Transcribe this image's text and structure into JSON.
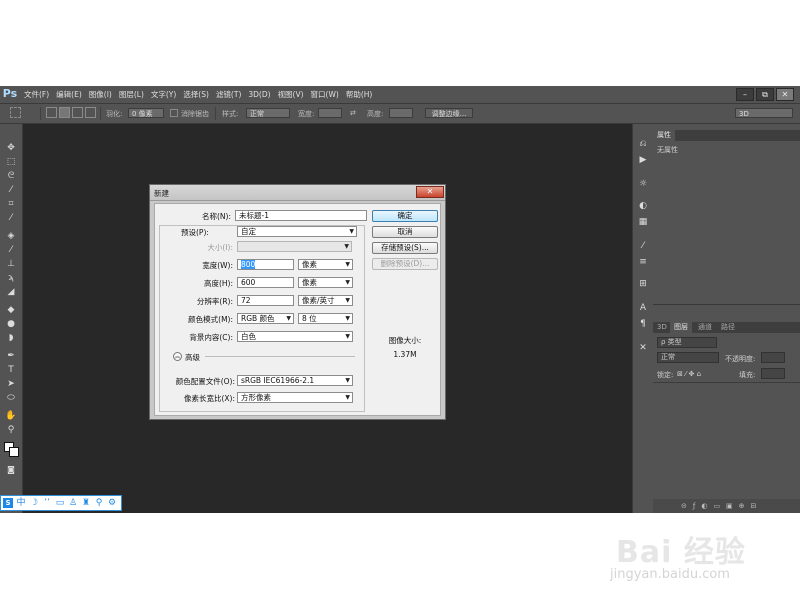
{
  "app": {
    "logo": "Ps"
  },
  "menubar": {
    "items": [
      "文件(F)",
      "编辑(E)",
      "图像(I)",
      "图层(L)",
      "文字(Y)",
      "选择(S)",
      "滤镜(T)",
      "3D(D)",
      "视图(V)",
      "窗口(W)",
      "帮助(H)"
    ],
    "window_buttons": [
      "–",
      "⧉",
      "✕"
    ]
  },
  "optionsbar": {
    "feather_label": "羽化:",
    "feather_value": "0 像素",
    "antialias_label": "消除锯齿",
    "style_label": "样式:",
    "style_value": "正常",
    "width_label": "宽度:",
    "height_label": "高度:",
    "refine_edge_label": "调整边缘...",
    "workspace_value": "3D"
  },
  "right_panel": {
    "properties_tab": "属性",
    "properties_empty": "无属性",
    "layer_tabs": [
      "3D",
      "图层",
      "通道",
      "路径"
    ],
    "kind_label": "ρ 类型",
    "blend_mode": "正常",
    "opacity_label": "不透明度:",
    "lock_label": "锁定:",
    "fill_label": "填充:"
  },
  "dialog": {
    "title": "新建",
    "close_glyph": "✕",
    "name_label": "名称(N):",
    "name_value": "未标题-1",
    "preset_label": "预设(P):",
    "preset_value": "自定",
    "size_label": "大小(I):",
    "width_label": "宽度(W):",
    "width_value": "800",
    "width_unit": "像素",
    "height_label": "高度(H):",
    "height_value": "600",
    "height_unit": "像素",
    "resolution_label": "分辨率(R):",
    "resolution_value": "72",
    "resolution_unit": "像素/英寸",
    "color_mode_label": "颜色模式(M):",
    "color_mode_value": "RGB 颜色",
    "bit_depth_value": "8 位",
    "bg_contents_label": "背景内容(C):",
    "bg_contents_value": "白色",
    "advanced_label": "高级",
    "color_profile_label": "颜色配置文件(O):",
    "color_profile_value": "sRGB IEC61966-2.1",
    "pixel_aspect_label": "像素长宽比(X):",
    "pixel_aspect_value": "方形像素",
    "buttons": {
      "ok": "确定",
      "cancel": "取消",
      "save_preset": "存储预设(S)...",
      "delete_preset": "删除预设(D)..."
    },
    "image_size_label": "图像大小:",
    "image_size_value": "1.37M"
  },
  "ime_bar": {
    "lang": "中"
  },
  "watermark": {
    "logo": "Bai 经验",
    "url": "jingyan.baidu.com"
  }
}
